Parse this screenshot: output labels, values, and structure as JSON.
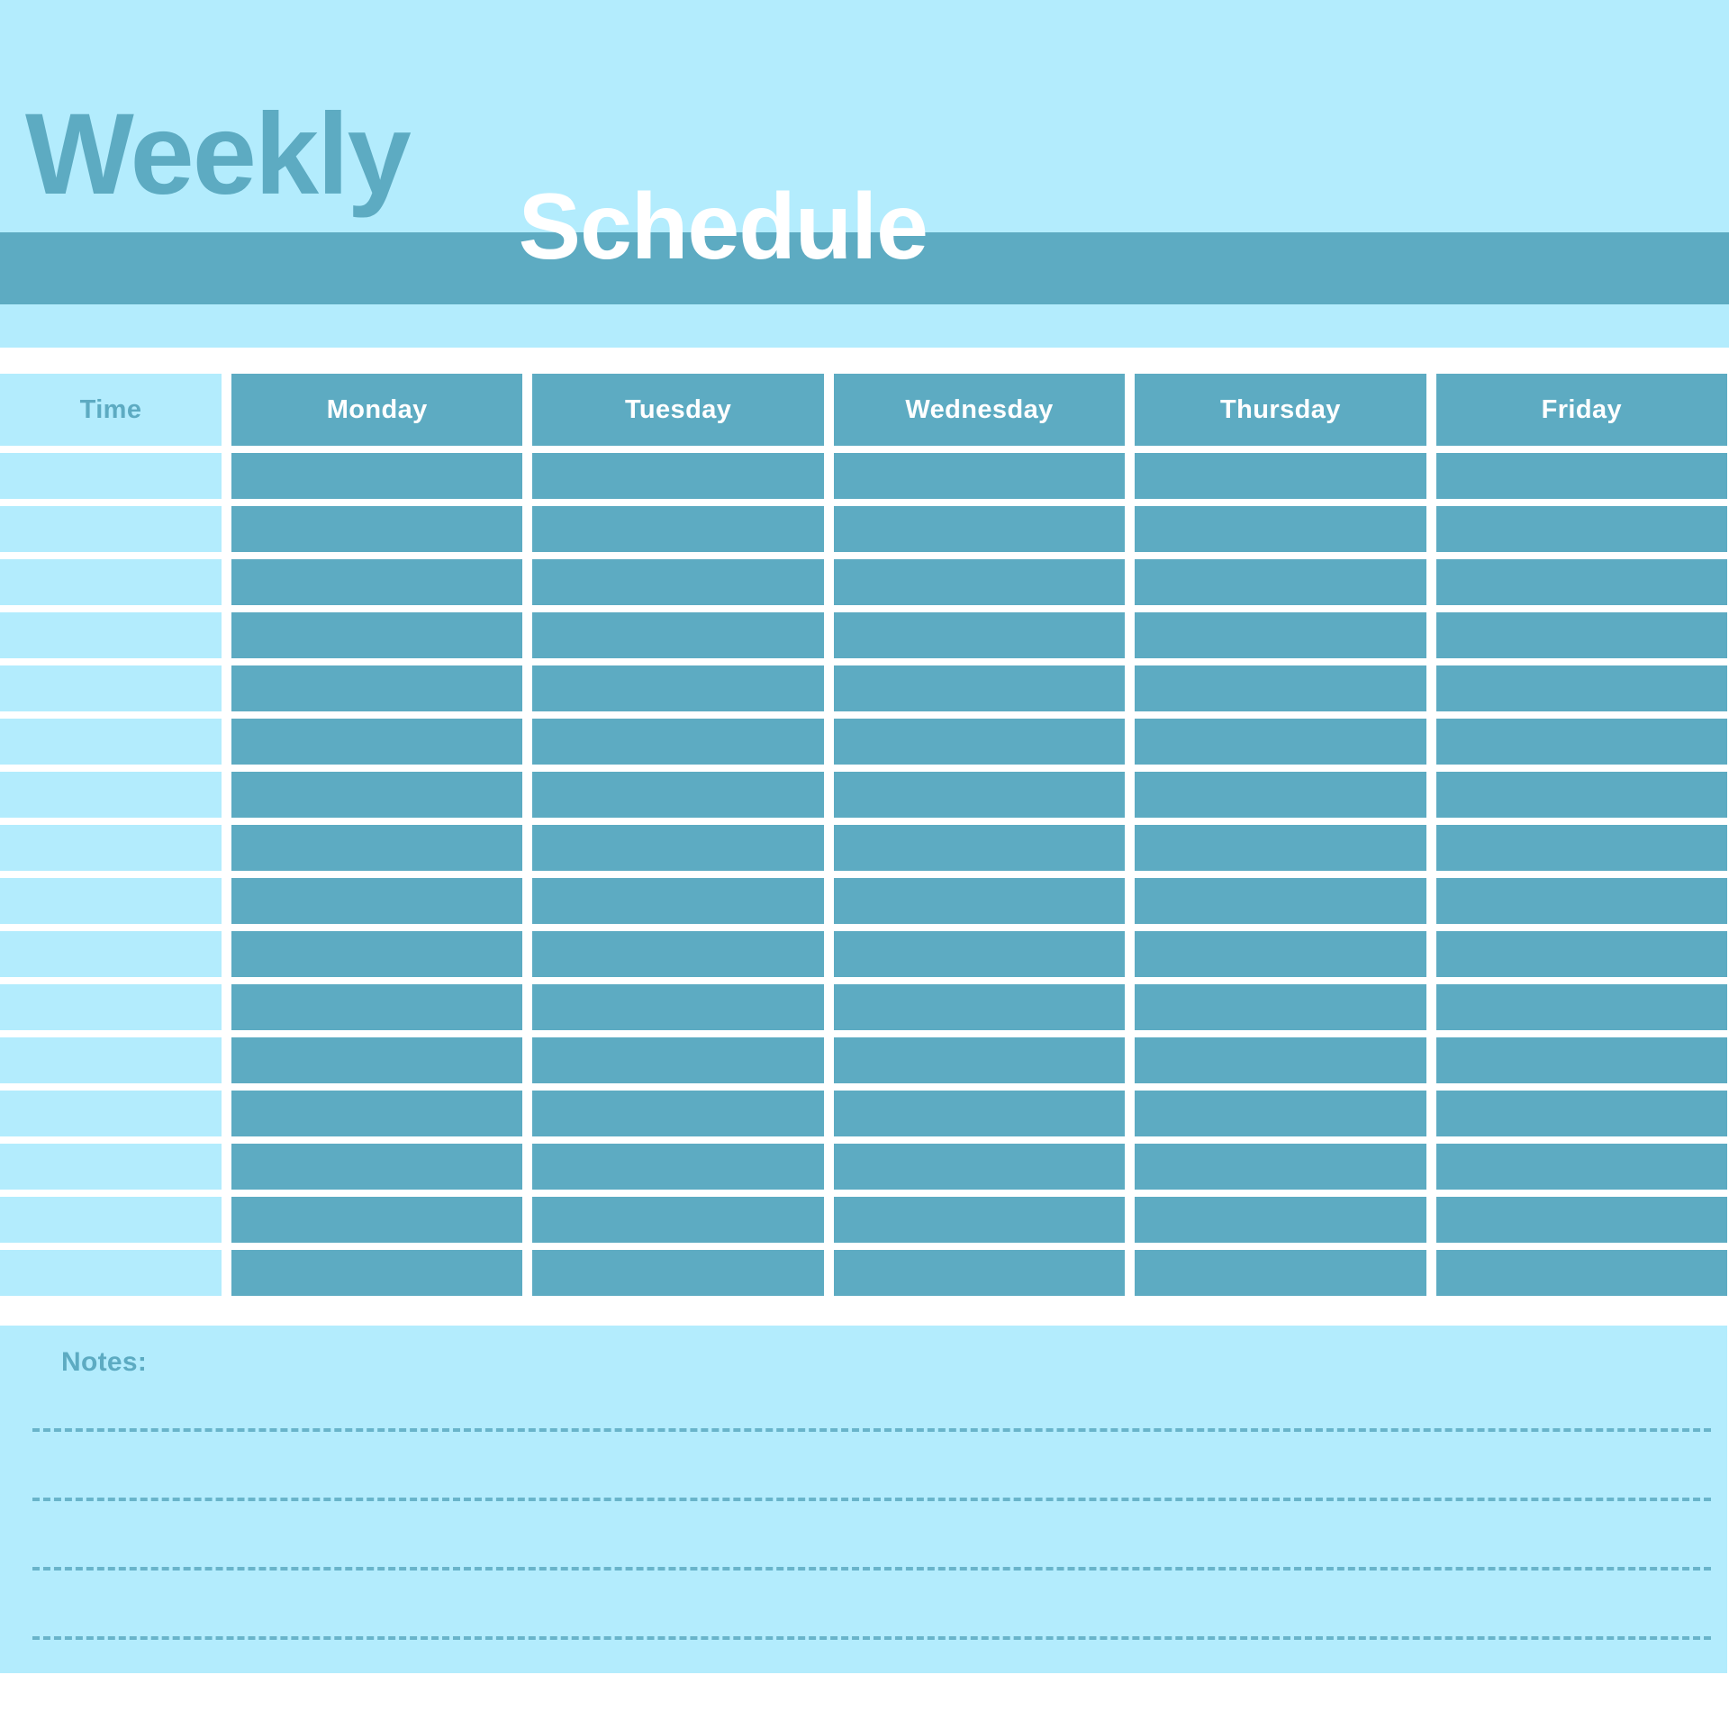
{
  "header": {
    "title_line1": "Weekly",
    "title_line2": "Schedule",
    "accent_color": "#5dabc2",
    "background_color": "#b3ecfd"
  },
  "table": {
    "columns": [
      {
        "label": "Time",
        "kind": "time"
      },
      {
        "label": "Monday",
        "kind": "day"
      },
      {
        "label": "Tuesday",
        "kind": "day"
      },
      {
        "label": "Wednesday",
        "kind": "day"
      },
      {
        "label": "Thursday",
        "kind": "day"
      },
      {
        "label": "Friday",
        "kind": "day"
      }
    ],
    "row_count": 16,
    "rows": [
      {
        "time": "",
        "monday": "",
        "tuesday": "",
        "wednesday": "",
        "thursday": "",
        "friday": ""
      },
      {
        "time": "",
        "monday": "",
        "tuesday": "",
        "wednesday": "",
        "thursday": "",
        "friday": ""
      },
      {
        "time": "",
        "monday": "",
        "tuesday": "",
        "wednesday": "",
        "thursday": "",
        "friday": ""
      },
      {
        "time": "",
        "monday": "",
        "tuesday": "",
        "wednesday": "",
        "thursday": "",
        "friday": ""
      },
      {
        "time": "",
        "monday": "",
        "tuesday": "",
        "wednesday": "",
        "thursday": "",
        "friday": ""
      },
      {
        "time": "",
        "monday": "",
        "tuesday": "",
        "wednesday": "",
        "thursday": "",
        "friday": ""
      },
      {
        "time": "",
        "monday": "",
        "tuesday": "",
        "wednesday": "",
        "thursday": "",
        "friday": ""
      },
      {
        "time": "",
        "monday": "",
        "tuesday": "",
        "wednesday": "",
        "thursday": "",
        "friday": ""
      },
      {
        "time": "",
        "monday": "",
        "tuesday": "",
        "wednesday": "",
        "thursday": "",
        "friday": ""
      },
      {
        "time": "",
        "monday": "",
        "tuesday": "",
        "wednesday": "",
        "thursday": "",
        "friday": ""
      },
      {
        "time": "",
        "monday": "",
        "tuesday": "",
        "wednesday": "",
        "thursday": "",
        "friday": ""
      },
      {
        "time": "",
        "monday": "",
        "tuesday": "",
        "wednesday": "",
        "thursday": "",
        "friday": ""
      },
      {
        "time": "",
        "monday": "",
        "tuesday": "",
        "wednesday": "",
        "thursday": "",
        "friday": ""
      },
      {
        "time": "",
        "monday": "",
        "tuesday": "",
        "wednesday": "",
        "thursday": "",
        "friday": ""
      },
      {
        "time": "",
        "monday": "",
        "tuesday": "",
        "wednesday": "",
        "thursday": "",
        "friday": ""
      },
      {
        "time": "",
        "monday": "",
        "tuesday": "",
        "wednesday": "",
        "thursday": "",
        "friday": ""
      }
    ]
  },
  "notes": {
    "label": "Notes:",
    "line_count": 4,
    "lines": [
      "",
      "",
      "",
      ""
    ]
  },
  "colors": {
    "light_blue": "#b3ecfd",
    "teal": "#5dabc2",
    "white": "#ffffff"
  }
}
